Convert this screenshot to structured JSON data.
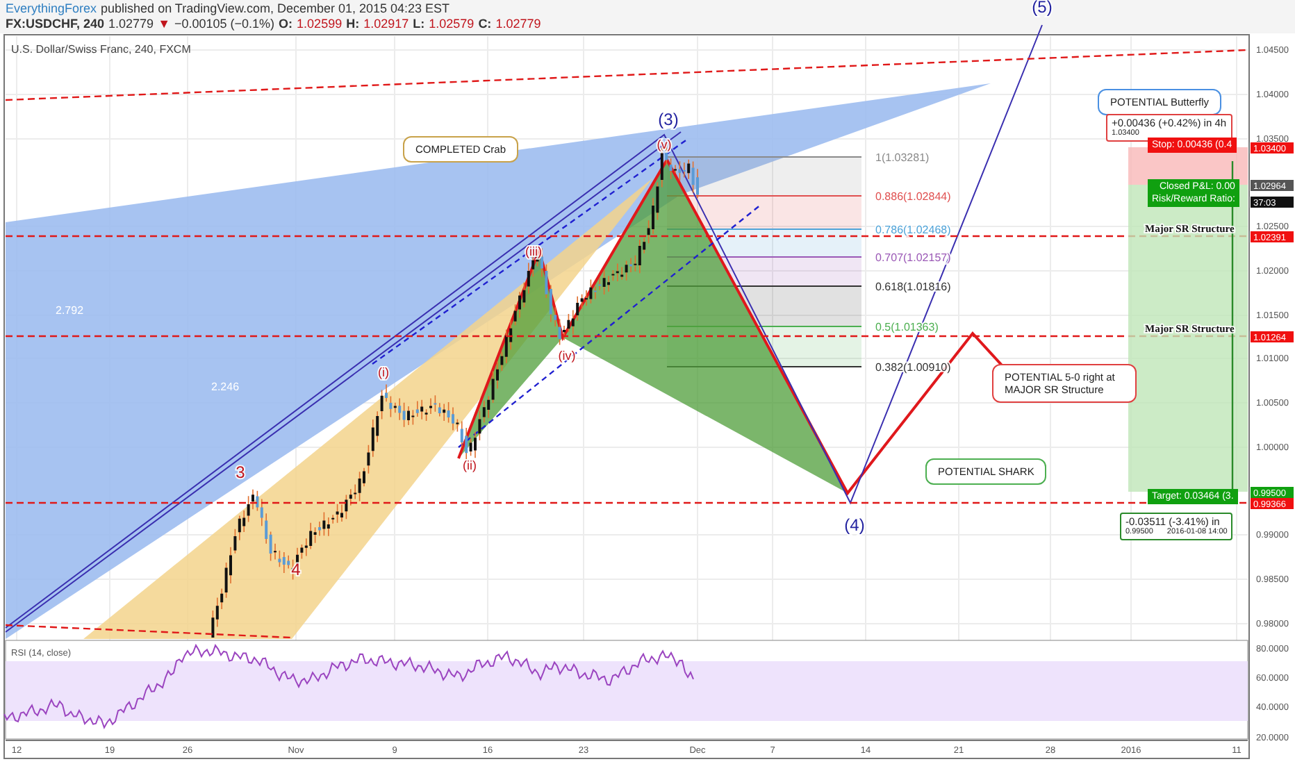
{
  "header": {
    "publisher": "EverythingForex",
    "published": "published on TradingView.com, December 01, 2015 04:23 EST",
    "symbol": "FX:USDCHF, 240",
    "last": "1.02779",
    "direction_icon": "▼",
    "change": "−0.00105 (−0.1%)",
    "ohlc": [
      {
        "label": "O:",
        "value": "1.02599"
      },
      {
        "label": "H:",
        "value": "1.02917"
      },
      {
        "label": "L:",
        "value": "1.02579"
      },
      {
        "label": "C:",
        "value": "1.02779"
      }
    ]
  },
  "chart": {
    "title": "U.S. Dollar/Swiss Franc, 240, FXCM",
    "price_ticks": [
      "1.04500",
      "1.04000",
      "1.03500",
      "1.02500",
      "1.02000",
      "1.01500",
      "1.01000",
      "1.00500",
      "1.00000",
      "0.99000",
      "0.98500",
      "0.98000"
    ],
    "price_labels": [
      {
        "text": "1.03400",
        "kind": "stop"
      },
      {
        "text": "1.02964",
        "kind": "last"
      },
      {
        "text": "37:03",
        "kind": "countdown"
      },
      {
        "text": "1.02391",
        "kind": "level"
      },
      {
        "text": "1.01264",
        "kind": "level"
      },
      {
        "text": "0.99500",
        "kind": "target"
      },
      {
        "text": "0.99366",
        "kind": "level"
      }
    ],
    "time_ticks": [
      "12",
      "19",
      "26",
      "Nov",
      "9",
      "16",
      "23",
      "Dec",
      "7",
      "14",
      "21",
      "28",
      "2016",
      "11"
    ],
    "wave_labels": [
      {
        "text": "(5)",
        "kind": "intermediate"
      },
      {
        "text": "(3)",
        "kind": "intermediate"
      },
      {
        "text": "(4)",
        "kind": "intermediate"
      },
      {
        "text": "(v)",
        "kind": "minor"
      },
      {
        "text": "(iii)",
        "kind": "minor"
      },
      {
        "text": "(iv)",
        "kind": "minor"
      },
      {
        "text": "(ii)",
        "kind": "minor"
      },
      {
        "text": "(i)",
        "kind": "minor"
      },
      {
        "text": "3",
        "kind": "primary"
      },
      {
        "text": "4",
        "kind": "primary"
      }
    ],
    "fan_labels": [
      "2.792",
      "2.246"
    ],
    "fib_levels": [
      {
        "text": "1(1.03281)",
        "color": "#8a8a8a"
      },
      {
        "text": "0.886(1.02844)",
        "color": "#e05050"
      },
      {
        "text": "0.786(1.02468)",
        "color": "#4fa3d8"
      },
      {
        "text": "0.707(1.02157)",
        "color": "#9b59b6"
      },
      {
        "text": "0.618(1.01816)",
        "color": "#333333"
      },
      {
        "text": "0.5(1.01363)",
        "color": "#4caf50"
      },
      {
        "text": "0.382(1.00910)",
        "color": "#333333"
      }
    ],
    "callouts": [
      {
        "text": "POTENTIAL Butterfly",
        "kind": "info"
      },
      {
        "text": "COMPLETED Crab",
        "kind": "done"
      },
      {
        "text": "POTENTIAL 5-0 right at MAJOR SR Structure",
        "kind": "warning"
      },
      {
        "text": "POTENTIAL SHARK",
        "kind": "target"
      }
    ],
    "sr_labels": [
      "Major SR Structure",
      "Major SR Structure"
    ],
    "position": {
      "stop": "Stop: 0.00436 (0.4",
      "pnl": [
        "Closed P&L: 0.00",
        "Risk/Reward Ratio:"
      ],
      "target": "Target: 0.03464 (3.",
      "stop_info": [
        "+0.00436 (+0.42%) in 4h",
        "1.03400"
      ],
      "target_info": [
        "-0.03511 (-3.41%) in",
        "0.99500",
        "2016-01-08 14:00"
      ]
    },
    "rsi": {
      "title": "RSI (14, close)",
      "ticks": [
        "80.0000",
        "60.0000",
        "40.0000",
        "20.0000"
      ]
    }
  }
}
